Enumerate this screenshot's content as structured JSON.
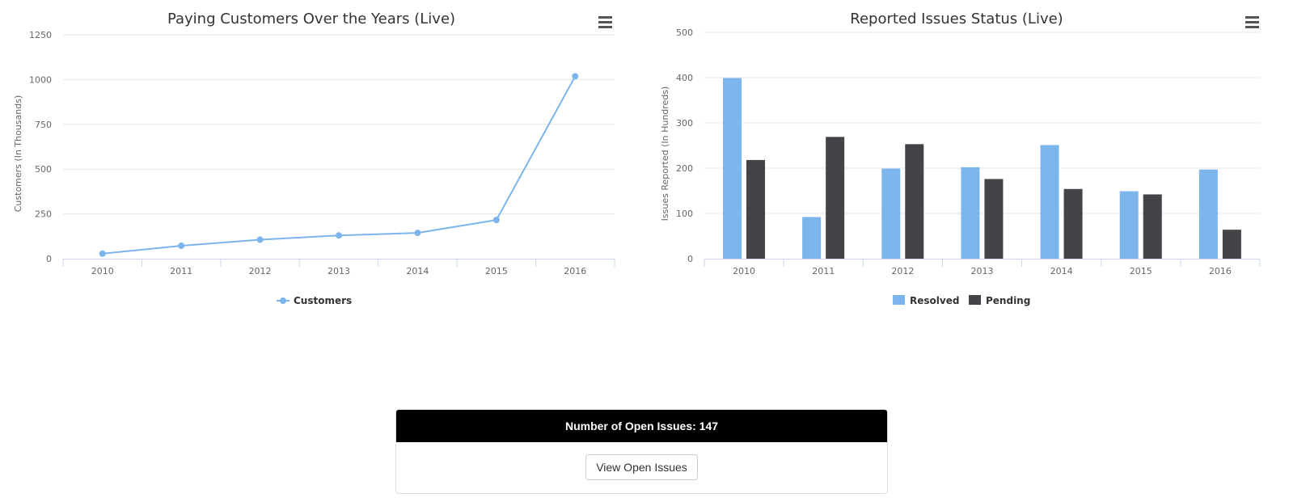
{
  "charts": {
    "customers": {
      "title": "Paying Customers Over the Years (Live)",
      "ylabel": "Customers (In Thousands)",
      "legend": "Customers",
      "color": "#7cb5ec"
    },
    "issues": {
      "title": "Reported Issues Status (Live)",
      "ylabel": "Issues Reported (In Hundreds)",
      "legend_resolved": "Resolved",
      "legend_pending": "Pending",
      "color_resolved": "#7cb5ec",
      "color_pending": "#434348"
    }
  },
  "chart_data": [
    {
      "type": "line",
      "title": "Paying Customers Over the Years (Live)",
      "xlabel": "",
      "ylabel": "Customers (In Thousands)",
      "categories": [
        "2010",
        "2011",
        "2012",
        "2013",
        "2014",
        "2015",
        "2016"
      ],
      "yticks": [
        "0",
        "250",
        "500",
        "750",
        "1000",
        "1250"
      ],
      "ylim": [
        0,
        1250
      ],
      "series": [
        {
          "name": "Customers",
          "values": [
            28,
            72,
            106,
            130,
            144,
            216,
            1018
          ]
        }
      ],
      "grid": true,
      "legend": "bottom-center"
    },
    {
      "type": "bar",
      "title": "Reported Issues Status (Live)",
      "xlabel": "",
      "ylabel": "Issues Reported (In Hundreds)",
      "categories": [
        "2010",
        "2011",
        "2012",
        "2013",
        "2014",
        "2015",
        "2016"
      ],
      "yticks": [
        "0",
        "100",
        "200",
        "300",
        "400",
        "500"
      ],
      "ylim": [
        0,
        500
      ],
      "series": [
        {
          "name": "Resolved",
          "values": [
            399,
            92,
            199,
            202,
            251,
            149,
            197
          ]
        },
        {
          "name": "Pending",
          "values": [
            218,
            269,
            253,
            176,
            154,
            142,
            64
          ]
        }
      ],
      "grid": true,
      "legend": "bottom-center"
    }
  ],
  "panel": {
    "heading": "Number of Open Issues: 147",
    "button_label": "View Open Issues"
  }
}
